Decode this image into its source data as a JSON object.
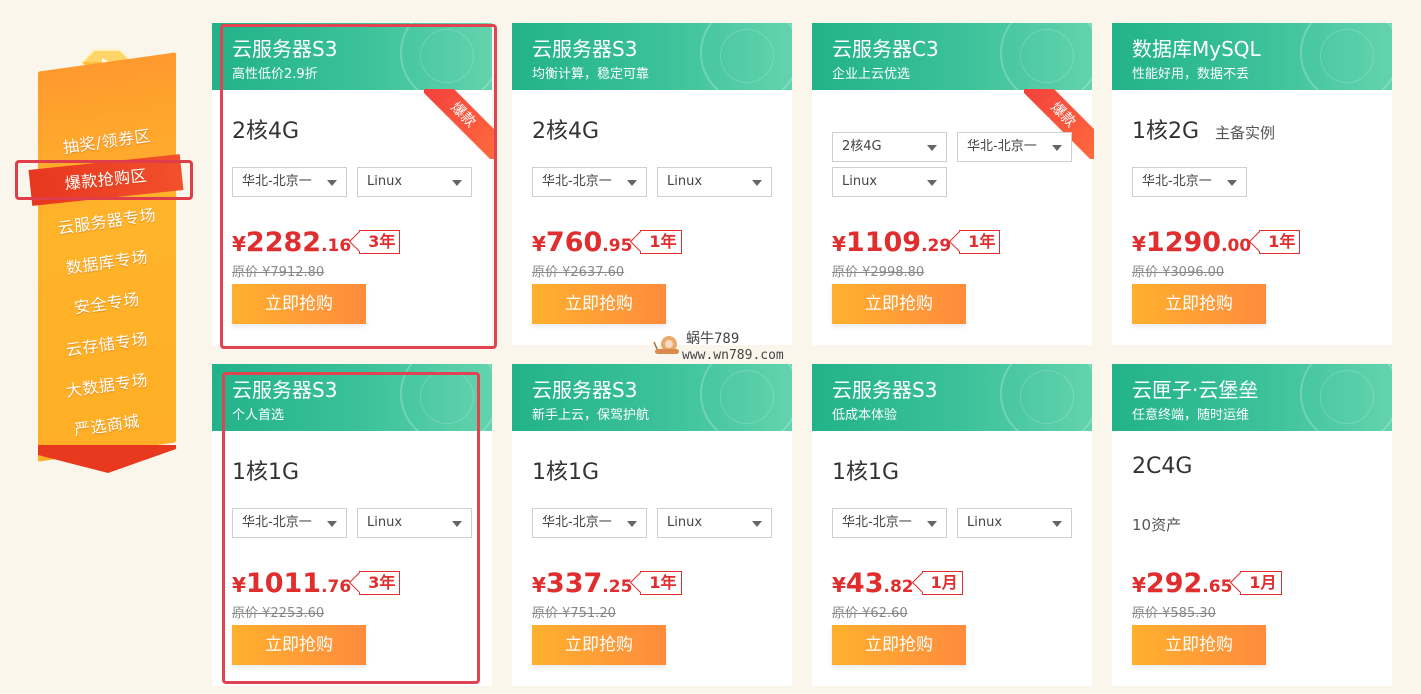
{
  "nav": {
    "items": [
      {
        "label": "抽奖/领券区"
      },
      {
        "label": "爆款抢购区"
      },
      {
        "label": "云服务器专场"
      },
      {
        "label": "数据库专场"
      },
      {
        "label": "安全专场"
      },
      {
        "label": "云存储专场"
      },
      {
        "label": "大数据专场"
      },
      {
        "label": "严选商城"
      }
    ],
    "active_index": 1,
    "flag_color": "#ffaa2b",
    "active_color": "#e8361f",
    "highlight_color": "#e03d4a"
  },
  "buy_label": "立即抢购",
  "hot_label": "爆款",
  "orig_prefix": "原价 ¥",
  "currency": "¥",
  "watermark": {
    "top": "蜗牛789",
    "bottom": "www.wn789.com"
  },
  "cards": [
    {
      "title": "云服务器S3",
      "subtitle": "高性低价2.9折",
      "spec": "2核4G",
      "region": "华北-北京一",
      "os": "Linux",
      "price_int": "2282",
      "price_dec": ".16",
      "term": "3年",
      "orig": "7912.80",
      "hot": true
    },
    {
      "title": "云服务器S3",
      "subtitle": "均衡计算，稳定可靠",
      "spec": "2核4G",
      "region": "华北-北京一",
      "os": "Linux",
      "price_int": "760",
      "price_dec": ".95",
      "term": "1年",
      "orig": "2637.60",
      "hot": false
    },
    {
      "title": "云服务器C3",
      "subtitle": "企业上云优选",
      "spec_select": "2核4G",
      "region": "华北-北京一",
      "os": "Linux",
      "price_int": "1109",
      "price_dec": ".29",
      "term": "1年",
      "orig": "2998.80",
      "hot": true
    },
    {
      "title": "数据库MySQL",
      "subtitle": "性能好用，数据不丢",
      "spec": "1核2G",
      "spec_note": "主备实例",
      "region": "华北-北京一",
      "price_int": "1290",
      "price_dec": ".00",
      "term": "1年",
      "orig": "3096.00",
      "hot": false
    },
    {
      "title": "云服务器S3",
      "subtitle": "个人首选",
      "spec": "1核1G",
      "region": "华北-北京一",
      "os": "Linux",
      "price_int": "1011",
      "price_dec": ".76",
      "term": "3年",
      "orig": "2253.60",
      "hot": false
    },
    {
      "title": "云服务器S3",
      "subtitle": "新手上云，保驾护航",
      "spec": "1核1G",
      "region": "华北-北京一",
      "os": "Linux",
      "price_int": "337",
      "price_dec": ".25",
      "term": "1年",
      "orig": "751.20",
      "hot": false
    },
    {
      "title": "云服务器S3",
      "subtitle": "低成本体验",
      "spec": "1核1G",
      "region": "华北-北京一",
      "os": "Linux",
      "price_int": "43",
      "price_dec": ".82",
      "term": "1月",
      "orig": "62.60",
      "hot": false
    },
    {
      "title": "云匣子·云堡垒",
      "subtitle": "任意终端，随时运维",
      "spec": "2C4G",
      "extra": "10资产",
      "price_int": "292",
      "price_dec": ".65",
      "term": "1月",
      "orig": "585.30",
      "hot": false
    }
  ]
}
